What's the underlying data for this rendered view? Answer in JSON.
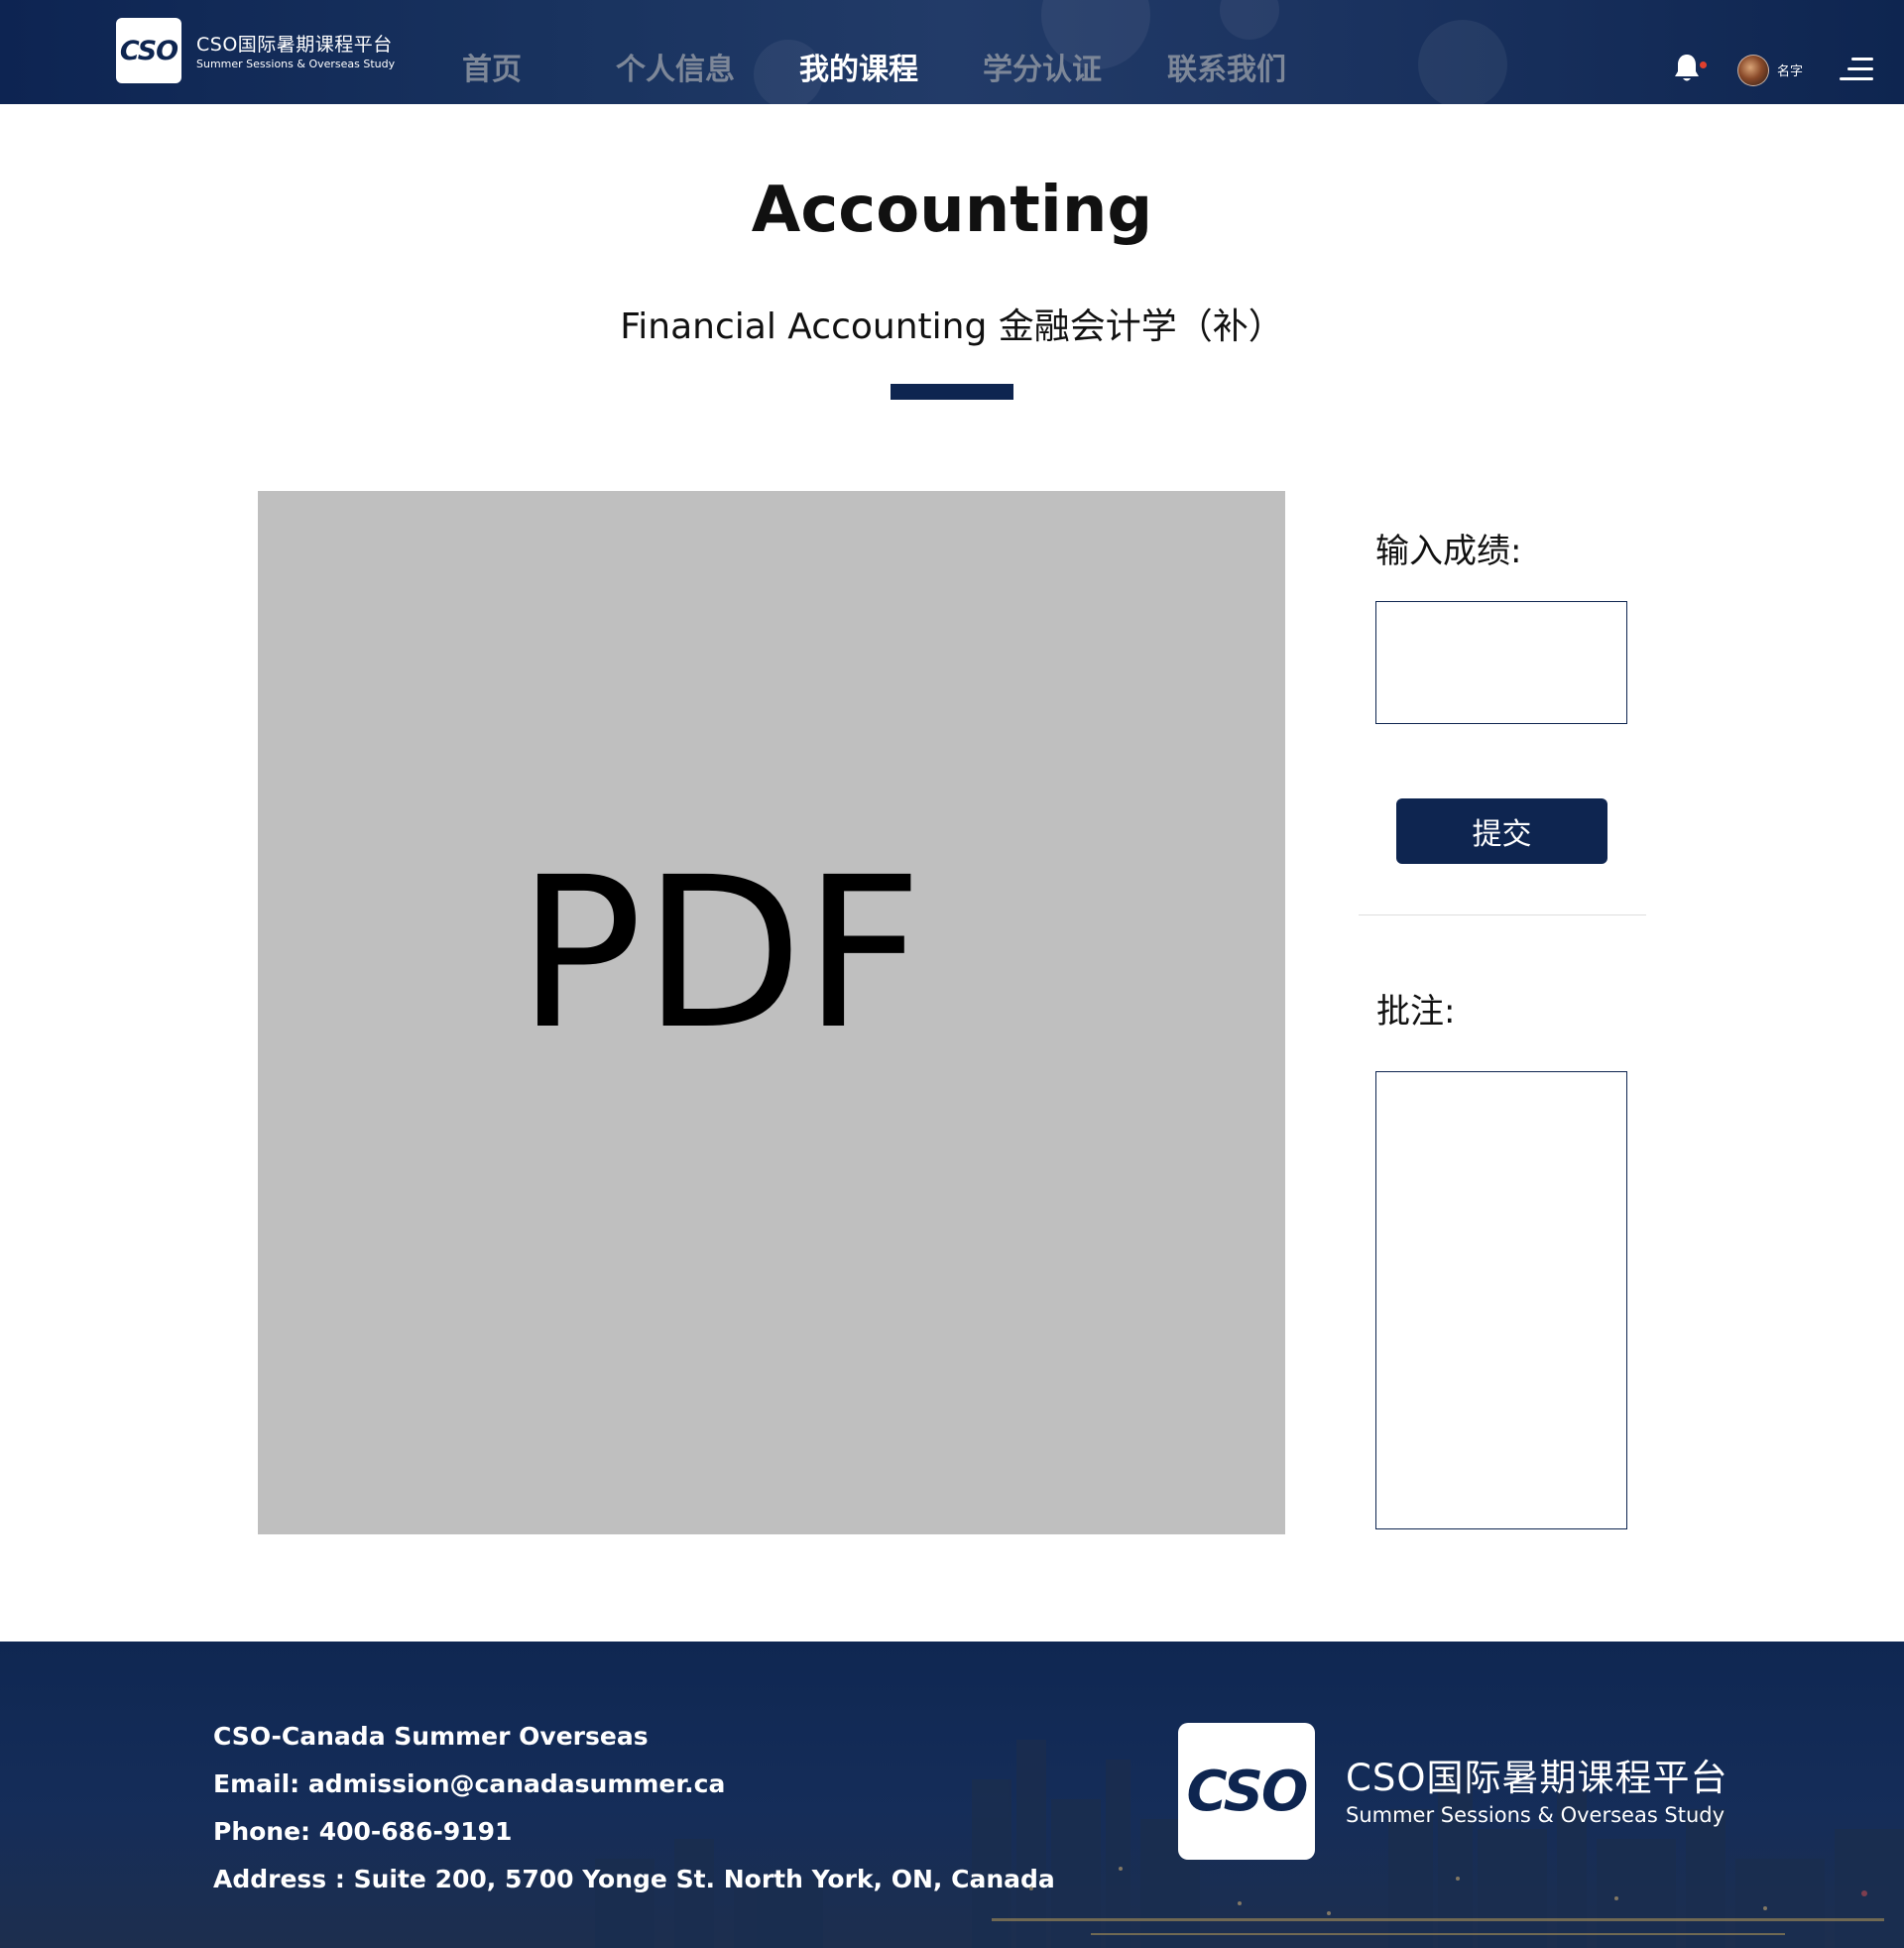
{
  "header": {
    "brand_cn": "CSO国际暑期课程平台",
    "brand_en": "Summer Sessions & Overseas Study",
    "logo_text": "CSO",
    "nav": [
      {
        "label": "首页",
        "active": false
      },
      {
        "label": "个人信息",
        "active": false
      },
      {
        "label": "我的课程",
        "active": true
      },
      {
        "label": "学分认证",
        "active": false
      },
      {
        "label": "联系我们",
        "active": false
      }
    ],
    "icons": [
      "bell-icon",
      "avatar",
      "menu-icon"
    ],
    "user_name": "名字"
  },
  "course": {
    "title": "Accounting",
    "subtitle": "Financial Accounting 金融会计学（补）"
  },
  "viewer": {
    "label": "PDF"
  },
  "panel": {
    "grade_label": "输入成绩:",
    "grade_value": "",
    "submit_label": "提交",
    "comment_label": "批注:",
    "comment_value": ""
  },
  "footer": {
    "lines": [
      "CSO-Canada Summer Overseas",
      "Email: admission@canadasummer.ca",
      "Phone: 400-686-9191",
      "Address : Suite 200, 5700 Yonge St. North York, ON, Canada"
    ],
    "logo_text": "CSO",
    "brand_cn": "CSO国际暑期课程平台",
    "brand_en": "Summer Sessions & Overseas Study"
  },
  "colors": {
    "primary": "#0e2550",
    "nav_inactive": "#7d8798",
    "viewer_bg": "#bfbfbf",
    "notification_dot": "#e0402e"
  }
}
